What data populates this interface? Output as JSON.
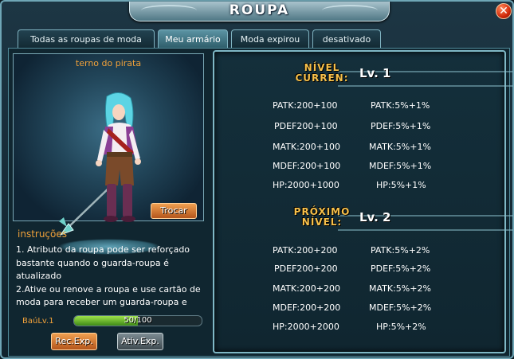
{
  "window": {
    "title": "ROUPA",
    "close_glyph": "✕"
  },
  "tabs": [
    {
      "label": "Todas as roupas de moda",
      "active": false
    },
    {
      "label": "Meu armário",
      "active": true
    },
    {
      "label": "Moda expirou",
      "active": false
    },
    {
      "label": "desativado",
      "active": false
    }
  ],
  "costume": {
    "name": "terno do pirata",
    "change_button": "Trocar"
  },
  "instructions": {
    "title": "instruções",
    "line1": "1. Atributo da roupa pode ser reforçado bastante quando o guarda-roupa é atualizado",
    "line2": " 2.Ative ou renove a roupa e use cartão de moda para receber um guarda-roupa e"
  },
  "wardrobe": {
    "level_label": "BaúLv.1",
    "xp_text": "50/100",
    "xp_current": 50,
    "xp_max": 100
  },
  "buttons": {
    "rec_exp": "Rec.Exp.",
    "ativ_exp": "Ativ.Exp."
  },
  "current": {
    "label_line1": "NÍVEL",
    "label_line2": "CURREN:",
    "level": "Lv. 1",
    "stats_left": [
      "PATK:200+100",
      "PDEF200+100",
      "MATK:200+100",
      "MDEF:200+100",
      "HP:2000+1000"
    ],
    "stats_right": [
      "PATK:5%+1%",
      "PDEF:5%+1%",
      "MATK:5%+1%",
      "MDEF:5%+1%",
      "HP:5%+1%"
    ]
  },
  "next": {
    "label_line1": "PRÓXIMO",
    "label_line2": "NÍVEL:",
    "level": "Lv. 2",
    "stats_left": [
      "PATK:200+200",
      "PDEF200+200",
      "MATK:200+200",
      "MDEF:200+200",
      "HP:2000+2000"
    ],
    "stats_right": [
      "PATK:5%+2%",
      "PDEF:5%+2%",
      "MATK:5%+2%",
      "MDEF:5%+2%",
      "HP:5%+2%"
    ]
  },
  "colors": {
    "accent_orange": "#f0a13a",
    "level_gold": "#f7c04a",
    "xp_green": "#7ccb34"
  },
  "icons": {
    "close": "close-icon",
    "character": "character-sprite",
    "spear": "spear-icon"
  }
}
